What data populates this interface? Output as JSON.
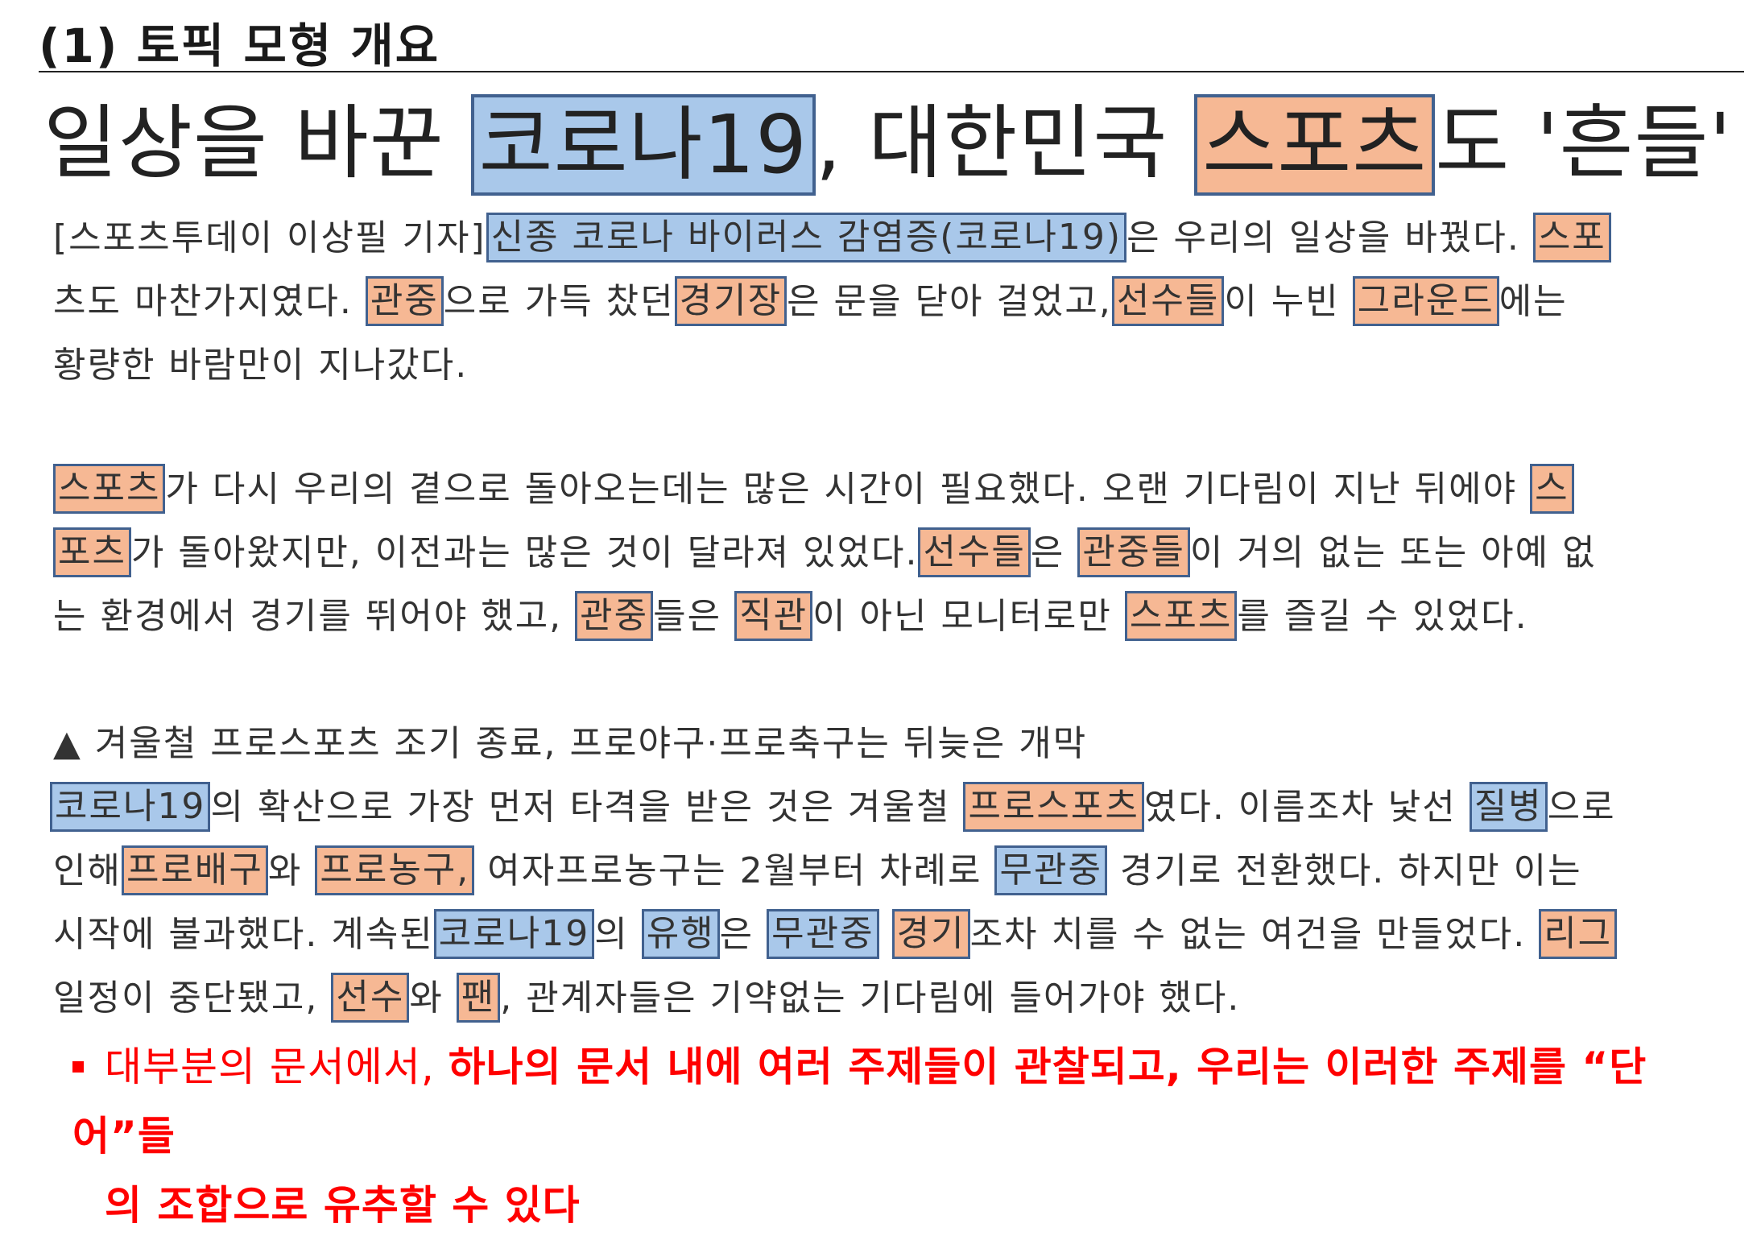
{
  "section_title": "(1) 토픽 모형 개요",
  "headline": {
    "pre": "일상을 바꾼 ",
    "hl1": "코로나19",
    "mid": ", 대한민국 ",
    "hl2": "스포츠",
    "post": "도 '흔들'"
  },
  "p1": {
    "l1_a": "[스포츠투데이 이상필 기자]",
    "l1_hl1": "신종 코로나 바이러스 감염증(코로나19)",
    "l1_b": "은 우리의 일상을 바꿨다.",
    "l1_hl2": "스포",
    "l2_hl0": "",
    "l2_a": "츠도 마찬가지였다.",
    "l2_hl1": "관중",
    "l2_b": "으로 가득 찼던",
    "l2_hl2": "경기장",
    "l2_c": "은 문을 닫아 걸었고,",
    "l2_hl3": "선수들",
    "l2_d": "이 누빈",
    "l2_hl4": "그라운드",
    "l2_e": "에는",
    "l3": "황량한 바람만이 지나갔다."
  },
  "p2": {
    "l1_hl1": "스포츠",
    "l1_a": "가 다시 우리의 곁으로 돌아오는데는 많은 시간이 필요했다. 오랜 기다림이 지난 뒤에야",
    "l1_hl2": "스",
    "l2_hl1": "포츠",
    "l2_a": "가 돌아왔지만, 이전과는 많은 것이 달라져 있었다.",
    "l2_hl2": "선수들",
    "l2_b": "은",
    "l2_hl3": "관중들",
    "l2_c": "이 거의 없는 또는 아예 없",
    "l3_a": "는 환경에서 경기를 뛰어야 했고,",
    "l3_hl1": "관중",
    "l3_b": "들은",
    "l3_hl2": "직관",
    "l3_c": "이 아닌 모니터로만",
    "l3_hl3": "스포츠",
    "l3_d": "를 즐길 수 있었다."
  },
  "p3": {
    "subhead": "▲ 겨울철 프로스포츠 조기 종료, 프로야구·프로축구는 뒤늦은 개막",
    "l1_hl1": "코로나19",
    "l1_a": "의 확산으로 가장 먼저 타격을 받은 것은 겨울철",
    "l1_hl2": "프로스포츠",
    "l1_b": "였다. 이름조차 낯선",
    "l1_hl3": "질병",
    "l1_c": "으로",
    "l2_a": "인해",
    "l2_hl1": "프로배구",
    "l2_b": "와",
    "l2_hl2": "프로농구,",
    "l2_c": " 여자프로농구는 2월부터 차례로",
    "l2_hl3": "무관중",
    "l2_d": " 경기로 전환했다. 하지만 이는",
    "l3_a": "시작에 불과했다. 계속된",
    "l3_hl1": "코로나19",
    "l3_b": "의",
    "l3_hl2": "유행",
    "l3_c": "은",
    "l3_hl3": "무관중",
    "l3_hl4": "경기",
    "l3_d": "조차 치를 수 없는 여건을 만들었다.",
    "l3_hl5": "리그",
    "l4_a": "일정이 중단됐고,",
    "l4_hl1": "선수",
    "l4_b": "와",
    "l4_hl2": "팬",
    "l4_c": ", 관계자들은 기약없는 기다림에 들어가야 했다."
  },
  "note": {
    "plain": "대부분의 문서에서, ",
    "bold": "하나의 문서 내에 여러 주제들이 관찰되고, 우리는 이러한 주제를 “단어”들",
    "line2": "의 조합으로 유추할 수 있다"
  },
  "colors": {
    "highlight_blue": "#a9c8ea",
    "highlight_orange": "#f6b894",
    "highlight_border": "#41618f",
    "note_red": "#ff0000"
  }
}
